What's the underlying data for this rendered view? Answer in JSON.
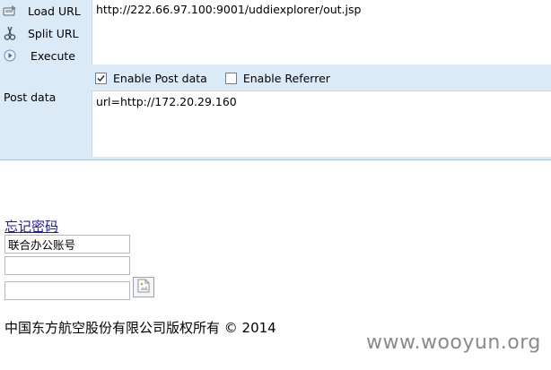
{
  "hackbar": {
    "buttons": {
      "load_url": "Load URL",
      "split_url": "Split URL",
      "execute": "Execute"
    },
    "url_value": "http://222.66.97.100:9001/uddiexplorer/out.jsp",
    "options": {
      "enable_post": {
        "label": "Enable Post data",
        "checked": true
      },
      "enable_referrer": {
        "label": "Enable Referrer",
        "checked": false
      }
    },
    "post_data_label": "Post data",
    "post_data_value": "url=http://172.20.29.160"
  },
  "page": {
    "forgot_password_link": "忘记密码",
    "account_field_value": "联合办公账号",
    "password_field_value": "",
    "captcha_field_value": "",
    "copyright": "中国东方航空股份有限公司版权所有 © 2014"
  },
  "watermark": "www.wooyun.org",
  "colors": {
    "toolbar_bg": "#dbeaf7",
    "link": "#1a1aa6",
    "watermark": "#8a8a8a"
  }
}
